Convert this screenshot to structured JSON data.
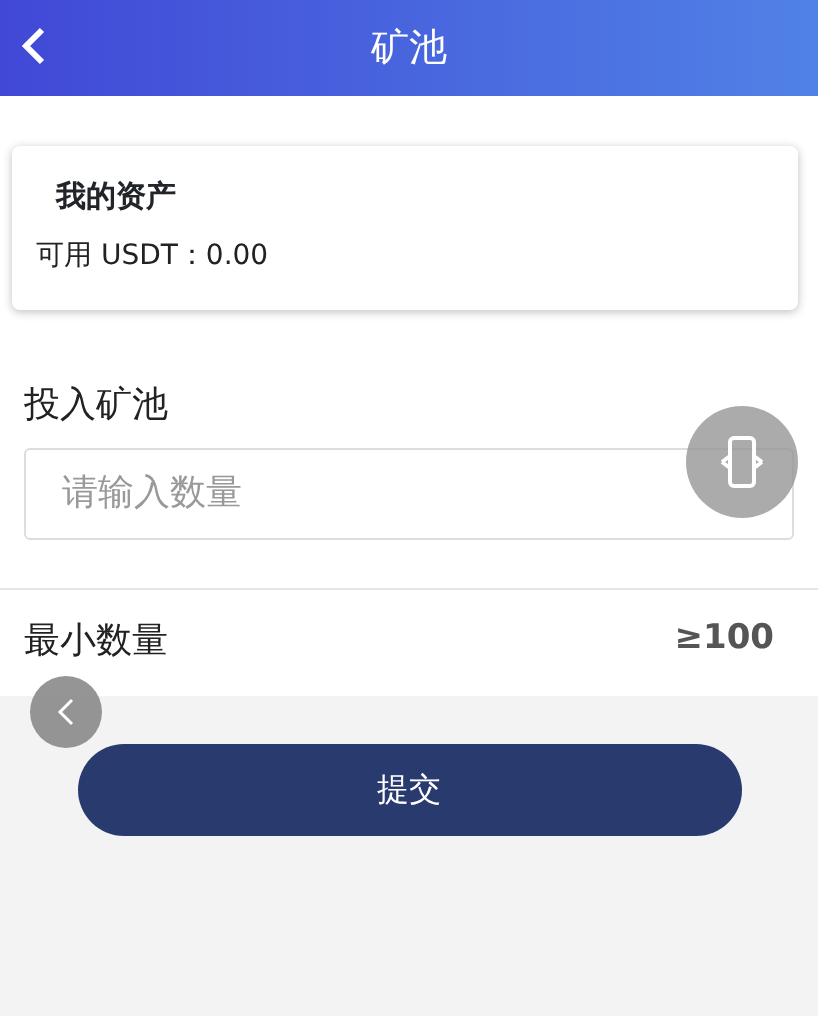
{
  "header": {
    "title": "矿池"
  },
  "assets": {
    "title": "我的资产",
    "balance": "可用 USDT：0.00"
  },
  "deposit": {
    "label": "投入矿池",
    "placeholder": "请输入数量"
  },
  "minimum": {
    "label": "最小数量",
    "value": "≥100"
  },
  "submit": "提交"
}
